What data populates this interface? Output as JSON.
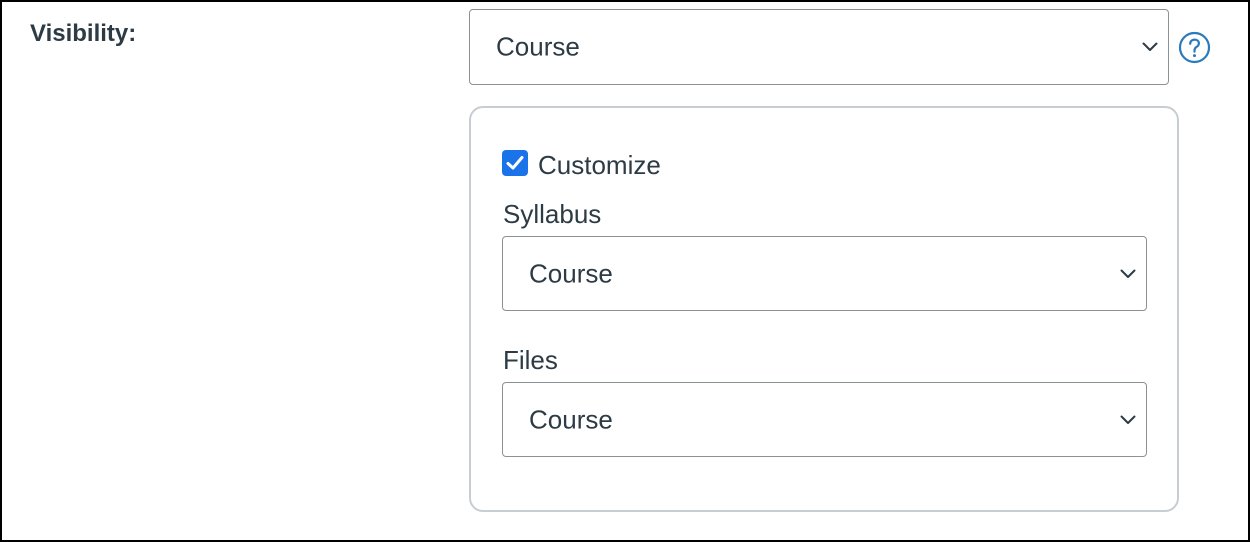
{
  "visibility": {
    "label": "Visibility:",
    "selected": "Course",
    "help_icon": "question-circle-icon"
  },
  "customize": {
    "label": "Customize",
    "checked": true
  },
  "syllabus": {
    "label": "Syllabus",
    "selected": "Course"
  },
  "files": {
    "label": "Files",
    "selected": "Course"
  },
  "colors": {
    "accent": "#1a73e8",
    "help": "#2b7abc",
    "text": "#2d3b45",
    "border": "#8b9296",
    "panel_border": "#c7cdd1"
  }
}
